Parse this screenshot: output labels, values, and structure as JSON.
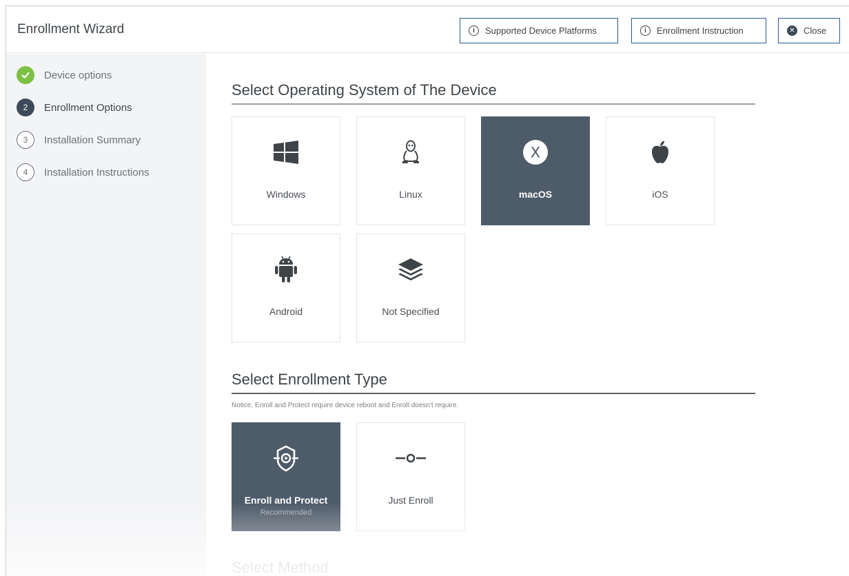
{
  "header": {
    "title": "Enrollment Wizard",
    "platforms_label": "Supported Device Platforms",
    "instruction_label": "Enrollment Instruction",
    "close_label": "Close"
  },
  "steps": [
    {
      "label": "Device options",
      "number": "",
      "state": "done"
    },
    {
      "label": "Enrollment Options",
      "number": "2",
      "state": "active"
    },
    {
      "label": "Installation Summary",
      "number": "3",
      "state": "todo"
    },
    {
      "label": "Installation Instructions",
      "number": "4",
      "state": "todo"
    }
  ],
  "os_section": {
    "title": "Select Operating System of The Device",
    "options": [
      {
        "label": "Windows",
        "icon": "windows-icon",
        "selected": false
      },
      {
        "label": "Linux",
        "icon": "linux-icon",
        "selected": false
      },
      {
        "label": "macOS",
        "icon": "macos-icon",
        "selected": true
      },
      {
        "label": "iOS",
        "icon": "apple-icon",
        "selected": false
      },
      {
        "label": "Android",
        "icon": "android-icon",
        "selected": false
      },
      {
        "label": "Not Specified",
        "icon": "layers-icon",
        "selected": false
      }
    ]
  },
  "enroll_section": {
    "title": "Select Enrollment Type",
    "note": "Notice, Enroll and Protect require device reboot and Enroll doesn't require.",
    "options": [
      {
        "label": "Enroll and Protect",
        "sub": "Recommended",
        "icon": "shield-target-icon",
        "selected": true
      },
      {
        "label": "Just Enroll",
        "icon": "connector-icon",
        "selected": false
      }
    ]
  },
  "method_section": {
    "title": "Select Method"
  },
  "colors": {
    "selected_tile": "#4e5b69",
    "done_step": "#7cc143",
    "active_step": "#3e4a59",
    "button_border": "#2c5a8f"
  }
}
